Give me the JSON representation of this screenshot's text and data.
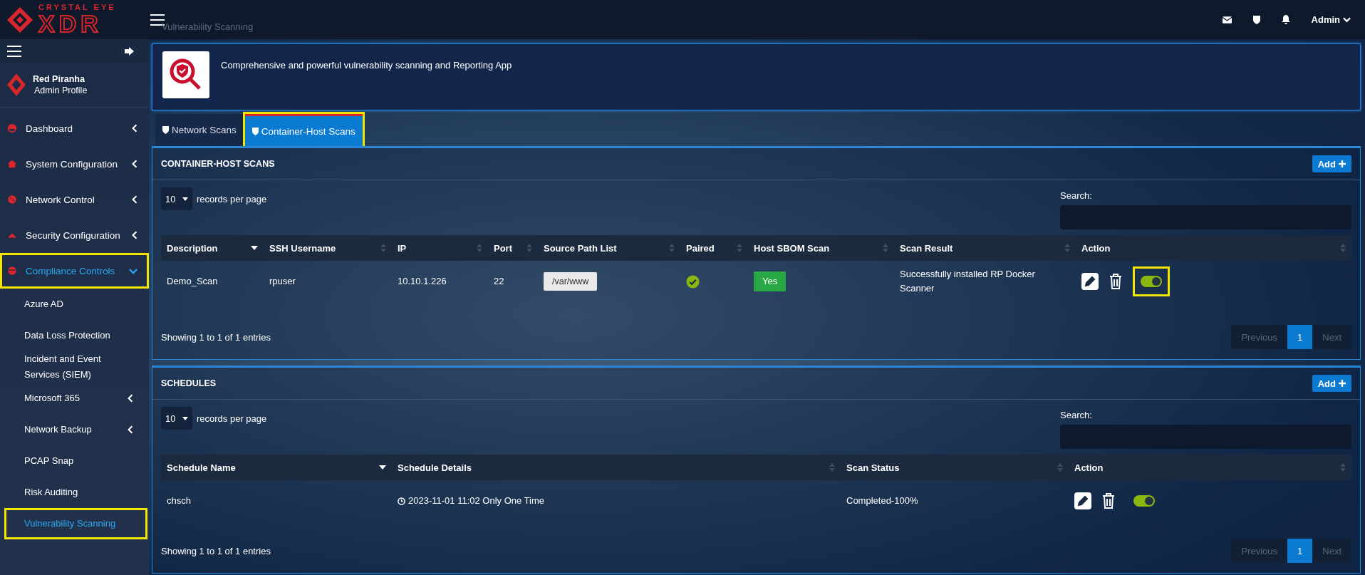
{
  "brand": {
    "line1": "CRYSTAL EYE",
    "line2": "XDR"
  },
  "page_title": "Vulnerability Scanning",
  "topbar": {
    "user": "Admin"
  },
  "profile": {
    "name": "Red Piranha",
    "role": "Admin Profile"
  },
  "sidebar": {
    "items": [
      {
        "label": "Dashboard",
        "selected": false,
        "expanded": false,
        "highlighted": false
      },
      {
        "label": "System Configuration",
        "selected": false,
        "expanded": false,
        "highlighted": false
      },
      {
        "label": "Network Control",
        "selected": false,
        "expanded": false,
        "highlighted": false
      },
      {
        "label": "Security Configuration",
        "selected": false,
        "expanded": false,
        "highlighted": false
      },
      {
        "label": "Compliance Controls",
        "selected": true,
        "expanded": true,
        "highlighted": true,
        "children": [
          {
            "label": "Azure AD",
            "selected": false,
            "expandable": false,
            "highlighted": false
          },
          {
            "label": "Data Loss Protection",
            "selected": false,
            "expandable": false,
            "highlighted": false
          },
          {
            "label": "Incident and Event Services (SIEM)",
            "selected": false,
            "expandable": false,
            "highlighted": false
          },
          {
            "label": "Microsoft 365",
            "selected": false,
            "expandable": true,
            "highlighted": false
          },
          {
            "label": "Network Backup",
            "selected": false,
            "expandable": true,
            "highlighted": false
          },
          {
            "label": "PCAP Snap",
            "selected": false,
            "expandable": false,
            "highlighted": false
          },
          {
            "label": "Risk Auditing",
            "selected": false,
            "expandable": false,
            "highlighted": false
          },
          {
            "label": "Vulnerability Scanning",
            "selected": true,
            "expandable": false,
            "highlighted": true
          }
        ]
      }
    ]
  },
  "banner": {
    "description": "Comprehensive and powerful vulnerability scanning and Reporting App"
  },
  "tabs": [
    {
      "label": "Network Scans",
      "selected": false,
      "highlighted": false
    },
    {
      "label": "Container-Host Scans",
      "selected": true,
      "highlighted": true
    }
  ],
  "panels": [
    {
      "title": "CONTAINER-HOST SCANS",
      "add_button": "Add",
      "page_size": "10",
      "page_size_label": "records per page",
      "search_label": "Search:",
      "columns": [
        {
          "label": "Description",
          "sortable": true,
          "sorted": true
        },
        {
          "label": "SSH Username",
          "sortable": true,
          "sorted": false
        },
        {
          "label": "IP",
          "sortable": true,
          "sorted": false
        },
        {
          "label": "Port",
          "sortable": true,
          "sorted": false
        },
        {
          "label": "Source Path List",
          "sortable": true,
          "sorted": false
        },
        {
          "label": "Paired",
          "sortable": true,
          "sorted": false
        },
        {
          "label": "Host SBOM Scan",
          "sortable": true,
          "sorted": false
        },
        {
          "label": "Scan Result",
          "sortable": true,
          "sorted": false
        },
        {
          "label": "Action",
          "sortable": true,
          "sorted": false
        }
      ],
      "rows": [
        {
          "cells": [
            {
              "kind": "text",
              "text": "Demo_Scan"
            },
            {
              "kind": "text",
              "text": "rpuser"
            },
            {
              "kind": "text",
              "text": "10.10.1.226"
            },
            {
              "kind": "text",
              "text": "22"
            },
            {
              "kind": "path",
              "text": "/var/www"
            },
            {
              "kind": "check",
              "checked": true
            },
            {
              "kind": "badge",
              "text": "Yes"
            },
            {
              "kind": "text",
              "text": "Successfully installed RP Docker Scanner"
            },
            {
              "kind": "actions",
              "on": true,
              "highlighted": true
            }
          ]
        }
      ],
      "info": "Showing 1 to 1 of 1 entries",
      "pagination": {
        "previous": {
          "label": "Previous",
          "disabled": true
        },
        "pages": [
          {
            "label": "1",
            "selected": true
          }
        ],
        "next": {
          "label": "Next",
          "disabled": true
        }
      }
    },
    {
      "title": "SCHEDULES",
      "add_button": "Add",
      "page_size": "10",
      "page_size_label": "records per page",
      "search_label": "Search:",
      "columns": [
        {
          "label": "Schedule Name",
          "sortable": true,
          "sorted": true
        },
        {
          "label": "Schedule Details",
          "sortable": true,
          "sorted": false
        },
        {
          "label": "Scan Status",
          "sortable": true,
          "sorted": false
        },
        {
          "label": "Action",
          "sortable": true,
          "sorted": false
        }
      ],
      "rows": [
        {
          "cells": [
            {
              "kind": "text",
              "text": "chsch"
            },
            {
              "kind": "datetime",
              "text": "2023-11-01 11:02 Only One Time"
            },
            {
              "kind": "text",
              "text": "Completed-100%"
            },
            {
              "kind": "actions",
              "on": true,
              "highlighted": false
            }
          ]
        }
      ],
      "info": "Showing 1 to 1 of 1 entries",
      "pagination": {
        "previous": {
          "label": "Previous",
          "disabled": true
        },
        "pages": [
          {
            "label": "1",
            "selected": true
          }
        ],
        "next": {
          "label": "Next",
          "disabled": true
        }
      }
    }
  ]
}
